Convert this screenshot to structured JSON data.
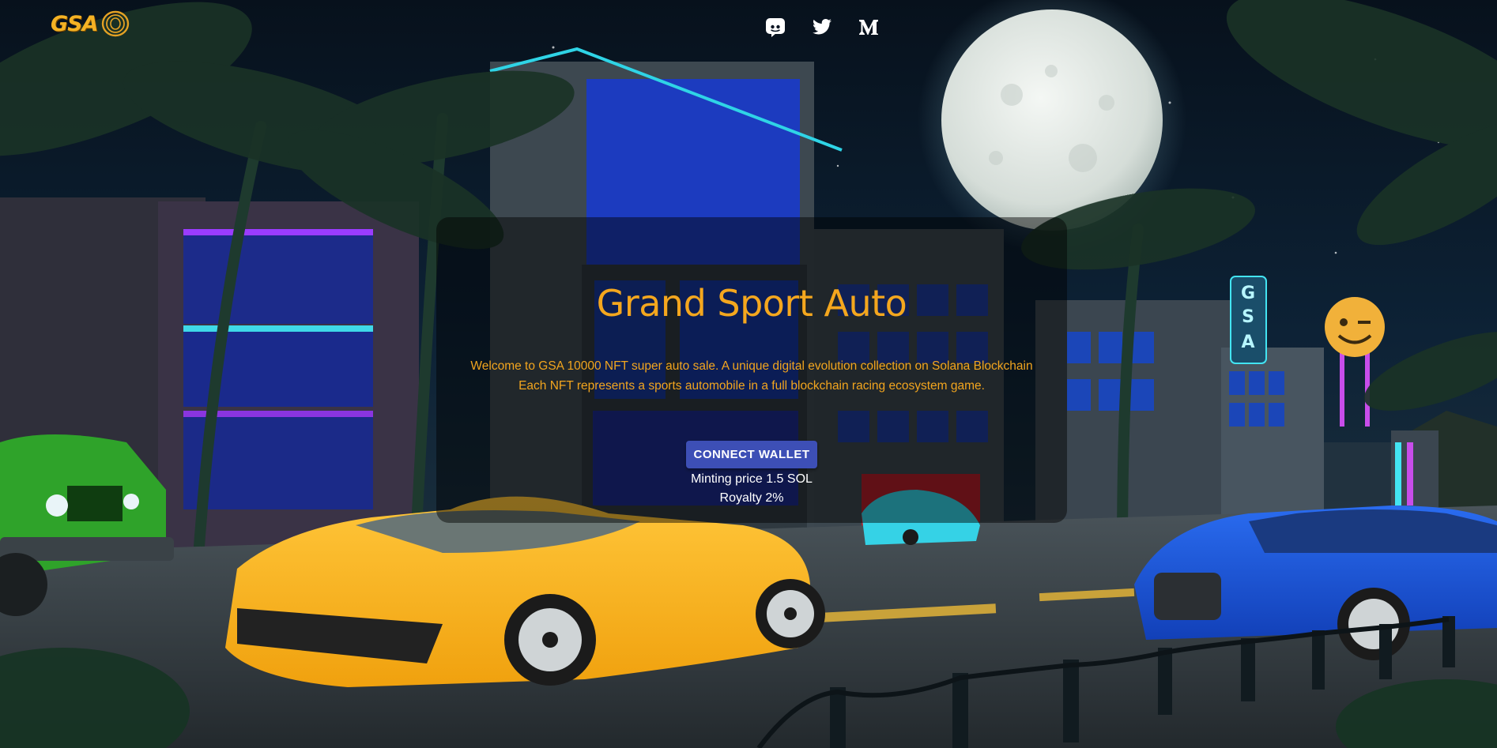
{
  "header": {
    "logo_text": "GSA",
    "social_links": [
      {
        "name": "Discord",
        "icon": "discord-icon"
      },
      {
        "name": "Twitter",
        "icon": "twitter-icon"
      },
      {
        "name": "Medium",
        "icon": "medium-icon"
      }
    ]
  },
  "hero": {
    "title": "Grand Sport Auto",
    "description_line1": "Welcome to GSA 10000 NFT super auto sale. A unique digital evolution collection on Solana Blockchain",
    "description_line2": "Each NFT represents a sports automobile in a full blockchain racing ecosystem game.",
    "connect_button_label": "CONNECT WALLET",
    "minting_price": "Minting price 1.5 SOL",
    "royalty": "Royalty 2%"
  },
  "background": {
    "moon_sign": "GSA"
  },
  "colors": {
    "accent": "#f4a71e",
    "button": "#3d4fb6",
    "sky": "#0a1422",
    "neon": "#2fd4e6"
  }
}
